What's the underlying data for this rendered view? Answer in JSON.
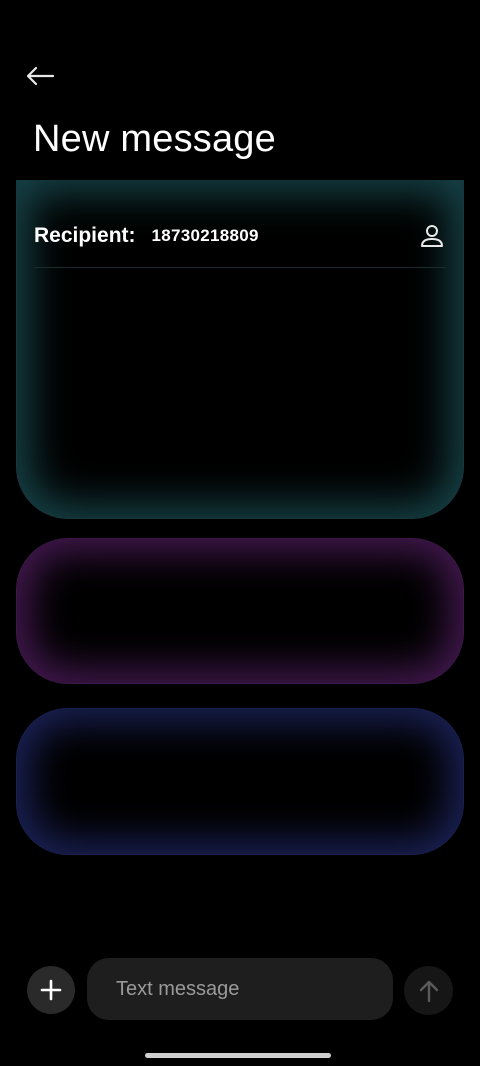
{
  "header": {
    "back_icon": "arrow-left-icon",
    "title": "New message"
  },
  "recipient": {
    "label": "Recipient:",
    "value": "18730218809",
    "contact_icon": "person-icon"
  },
  "composer": {
    "add_icon": "plus-icon",
    "placeholder": "Text message",
    "value": "",
    "send_icon": "arrow-up-icon"
  },
  "colors": {
    "background": "#000000",
    "card_teal_glow": "#287882",
    "card_purple_glow": "#6e2882",
    "card_blue_glow": "#283282",
    "input_bg": "#1e1e1e",
    "button_bg": "#2a2a2a",
    "send_button_bg": "#161616"
  }
}
